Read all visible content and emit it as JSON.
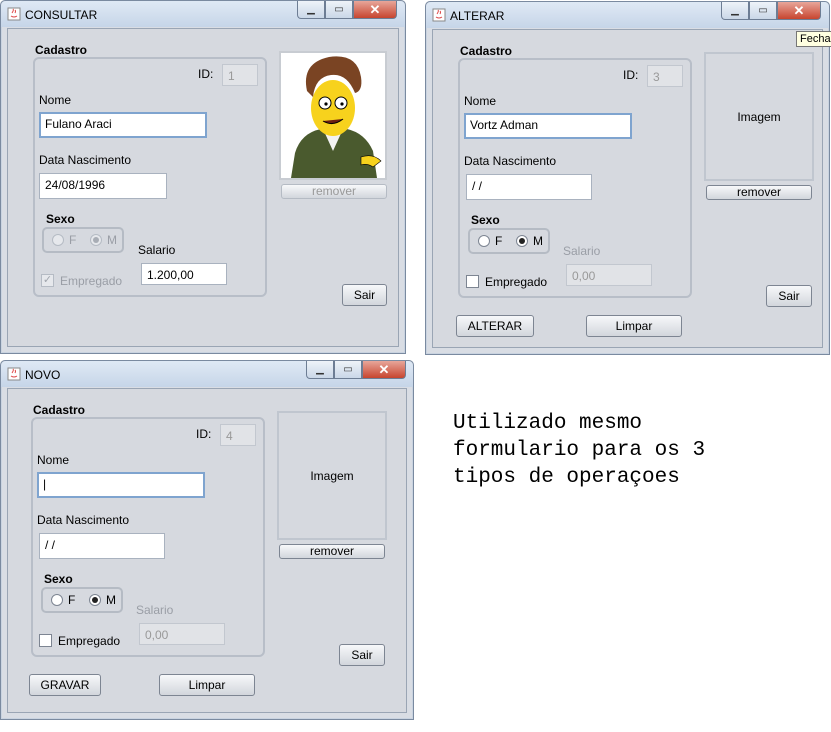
{
  "windows": {
    "consultar": {
      "title": "CONSULTAR",
      "group_label": "Cadastro",
      "id_label": "ID:",
      "id_value": "1",
      "nome_label": "Nome",
      "nome_value": "Fulano Araci",
      "data_label": "Data Nascimento",
      "data_value": "24/08/1996",
      "sexo_label": "Sexo",
      "sexo_f": "F",
      "sexo_m": "M",
      "salario_label": "Salario",
      "salario_value": "1.200,00",
      "empregado_label": "Empregado",
      "remover_label": "remover",
      "sair_label": "Sair"
    },
    "alterar": {
      "title": "ALTERAR",
      "group_label": "Cadastro",
      "id_label": "ID:",
      "id_value": "3",
      "nome_label": "Nome",
      "nome_value": "Vortz Adman",
      "data_label": "Data Nascimento",
      "data_value": " / /",
      "sexo_label": "Sexo",
      "sexo_f": "F",
      "sexo_m": "M",
      "salario_label": "Salario",
      "salario_value": "0,00",
      "empregado_label": "Empregado",
      "image_label": "Imagem",
      "remover_label": "remover",
      "sair_label": "Sair",
      "alterar_label": "ALTERAR",
      "limpar_label": "Limpar",
      "tooltip": "Fecha"
    },
    "novo": {
      "title": "NOVO",
      "group_label": "Cadastro",
      "id_label": "ID:",
      "id_value": "4",
      "nome_label": "Nome",
      "nome_value": "",
      "data_label": "Data Nascimento",
      "data_value": " / /",
      "sexo_label": "Sexo",
      "sexo_f": "F",
      "sexo_m": "M",
      "salario_label": "Salario",
      "salario_value": "0,00",
      "empregado_label": "Empregado",
      "image_label": "Imagem",
      "remover_label": "remover",
      "sair_label": "Sair",
      "gravar_label": "GRAVAR",
      "limpar_label": "Limpar"
    }
  },
  "note": "Utilizado mesmo\nformulario para os 3\ntipos de operaçoes",
  "icons": {
    "window_icon": "java-icon",
    "minimize": "minimize-icon",
    "maximize": "maximize-icon",
    "close": "close-icon"
  }
}
